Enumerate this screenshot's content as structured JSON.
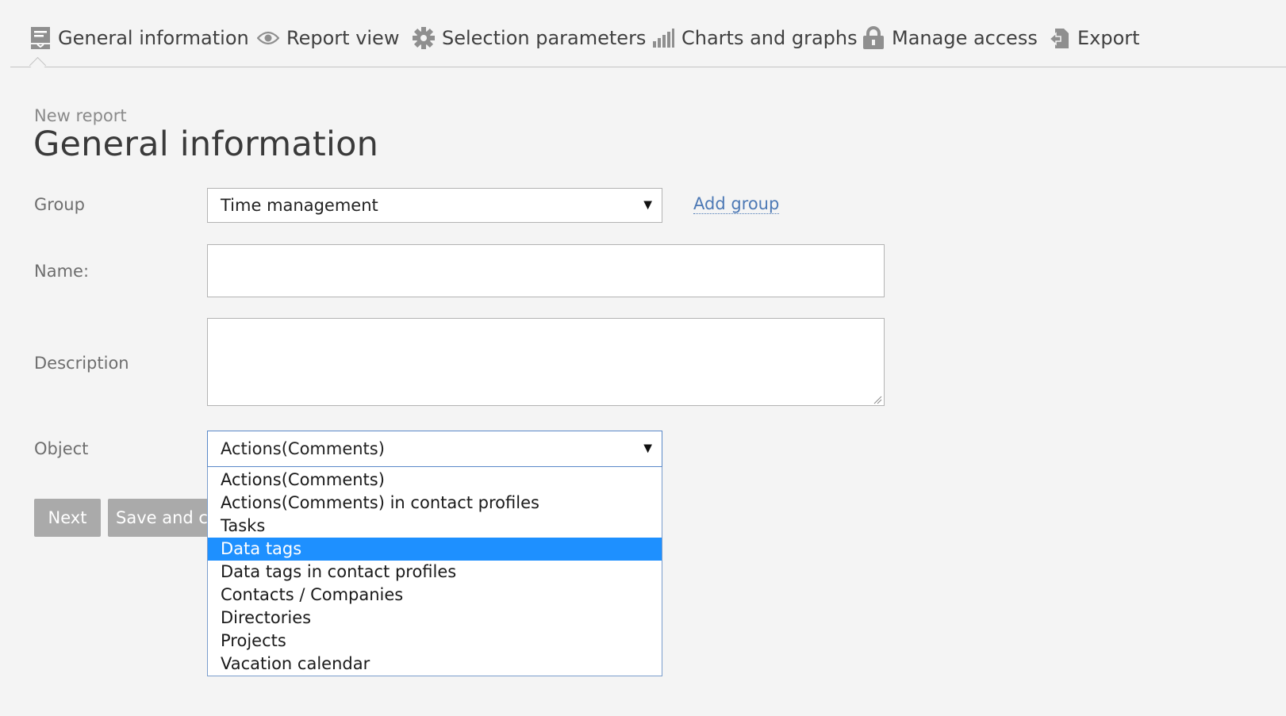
{
  "tabs": {
    "general": "General information",
    "report_view": "Report view",
    "selection": "Selection parameters",
    "charts": "Charts and graphs",
    "access": "Manage access",
    "export": "Export"
  },
  "header": {
    "breadcrumb": "New report",
    "title": "General information"
  },
  "form": {
    "group_label": "Group",
    "group_value": "Time management",
    "add_group": "Add group",
    "name_label": "Name:",
    "name_value": "",
    "description_label": "Description",
    "description_value": "",
    "object_label": "Object",
    "object_value": "Actions(Comments)"
  },
  "buttons": {
    "next": "Next",
    "save_close": "Save and cl"
  },
  "dropdown": {
    "options": [
      "Actions(Comments)",
      "Actions(Comments) in contact profiles",
      "Tasks",
      "Data tags",
      "Data tags in contact profiles",
      "Contacts / Companies",
      "Directories",
      "Projects",
      "Vacation calendar"
    ],
    "highlighted": "Data tags"
  },
  "icons": {
    "general": "form-icon",
    "report_view": "eye-icon",
    "selection": "gear-icon",
    "charts": "bar-chart-icon",
    "access": "lock-icon",
    "export": "export-icon",
    "select_arrow": "caret-down-icon"
  },
  "colors": {
    "background": "#f4f4f4",
    "link": "#4d79b5",
    "highlight": "#1e90ff",
    "button": "#aaaaaa",
    "icon": "#8f8f8f"
  }
}
